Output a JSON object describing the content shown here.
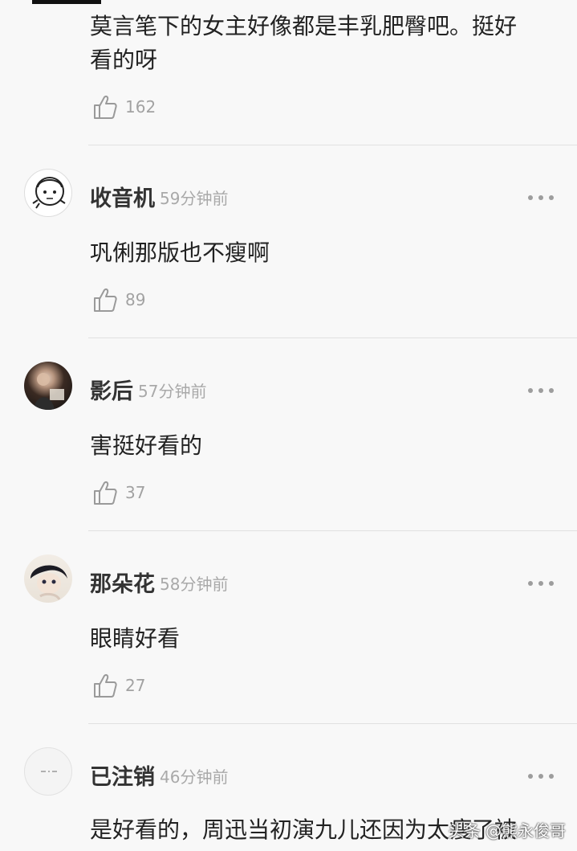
{
  "comments": [
    {
      "text_lines": [
        "莫言笔下的女主好像都是丰乳肥臀吧。挺好",
        "看的呀"
      ],
      "likes": "162"
    },
    {
      "username": "收音机",
      "time": "59分钟前",
      "text": "巩俐那版也不瘦啊",
      "likes": "89"
    },
    {
      "username": "影后",
      "time": "57分钟前",
      "text": "害挺好看的",
      "likes": "37"
    },
    {
      "username": "那朵花",
      "time": "58分钟前",
      "text": "眼睛好看",
      "likes": "27"
    },
    {
      "username": "已注销",
      "time": "46分钟前",
      "text": "是好看的，周迅当初演九儿还因为太瘦了被"
    }
  ],
  "icons": {
    "like": "thumbs-up-icon",
    "more": "more-dots-icon"
  },
  "watermark": "头条 @熊永俊哥",
  "colors": {
    "background": "#f8f8f8",
    "text": "#222222",
    "meta": "#a9a9a9",
    "divider": "#e1e1e1"
  }
}
